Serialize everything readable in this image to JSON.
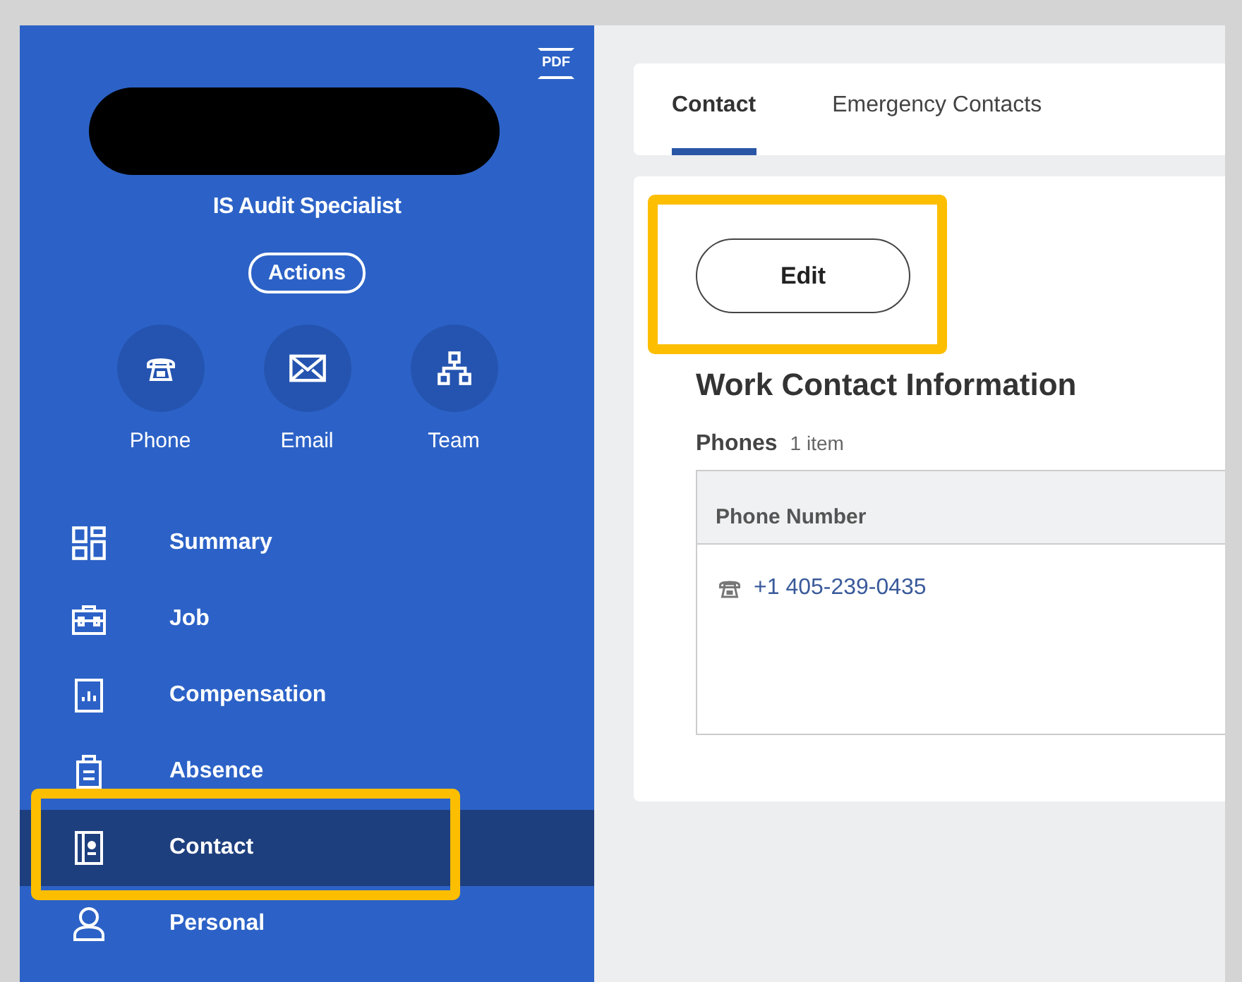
{
  "sidebar": {
    "pdf_label": "PDF",
    "name_redacted": true,
    "job_title": "IS Audit Specialist",
    "actions_button": "Actions",
    "quick_actions": [
      {
        "kind": "phone",
        "label": "Phone"
      },
      {
        "kind": "email",
        "label": "Email"
      },
      {
        "kind": "team",
        "label": "Team"
      }
    ],
    "nav_items": [
      {
        "kind": "summary",
        "label": "Summary",
        "selected": false,
        "highlighted": false
      },
      {
        "kind": "job",
        "label": "Job",
        "selected": false,
        "highlighted": false
      },
      {
        "kind": "compensation",
        "label": "Compensation",
        "selected": false,
        "highlighted": false
      },
      {
        "kind": "absence",
        "label": "Absence",
        "selected": false,
        "highlighted": false
      },
      {
        "kind": "contact",
        "label": "Contact",
        "selected": true,
        "highlighted": true
      },
      {
        "kind": "personal",
        "label": "Personal",
        "selected": false,
        "highlighted": false
      }
    ]
  },
  "tabs": [
    {
      "label": "Contact",
      "selected": true
    },
    {
      "label": "Emergency Contacts",
      "selected": false
    }
  ],
  "edit_button": {
    "label": "Edit",
    "highlighted": true
  },
  "section_title": "Work Contact Information",
  "phones": {
    "label": "Phones",
    "count": "1 item",
    "columns": [
      "Phone Number"
    ],
    "rows": [
      {
        "number": "+1 405-239-0435"
      }
    ]
  }
}
